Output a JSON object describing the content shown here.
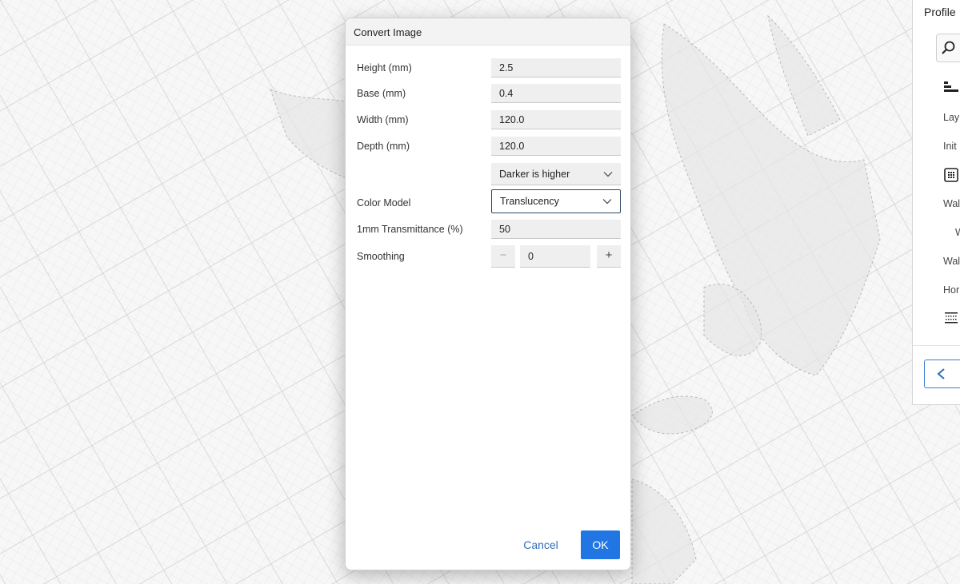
{
  "dialog": {
    "title": "Convert Image",
    "fields": [
      {
        "label": "Height (mm)",
        "value": "2.5"
      },
      {
        "label": "Base (mm)",
        "value": "0.4"
      },
      {
        "label": "Width (mm)",
        "value": "120.0"
      },
      {
        "label": "Depth (mm)",
        "value": "120.0"
      }
    ],
    "height_mode": {
      "value": "Darker is higher"
    },
    "color_model": {
      "label": "Color Model",
      "value": "Translucency"
    },
    "transmittance": {
      "label": "1mm Transmittance (%)",
      "value": "50"
    },
    "smoothing": {
      "label": "Smoothing",
      "value": "0",
      "minus": "−",
      "plus": "+"
    },
    "buttons": {
      "cancel": "Cancel",
      "ok": "OK"
    }
  },
  "side_panel": {
    "title": "Profile",
    "items": [
      "Lay",
      "Init",
      "Wal",
      "W",
      "Wal",
      "Hor"
    ]
  },
  "colors": {
    "accent": "#2276e3",
    "cancel_text": "#2f6db6",
    "build_plate_grid": "#d9d9d9"
  },
  "icons": [
    "search-icon",
    "layers-icon",
    "shell-icon",
    "infill-icon",
    "chevron-left-icon",
    "chevron-down-icon"
  ]
}
